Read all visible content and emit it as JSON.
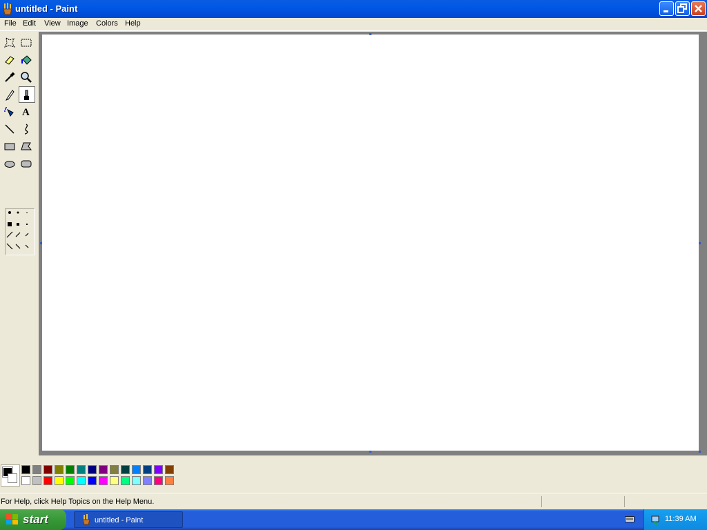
{
  "window": {
    "title": "untitled - Paint"
  },
  "menu": [
    "File",
    "Edit",
    "View",
    "Image",
    "Colors",
    "Help"
  ],
  "tools": [
    {
      "name": "free-form-select-icon"
    },
    {
      "name": "select-icon"
    },
    {
      "name": "eraser-icon"
    },
    {
      "name": "fill-icon"
    },
    {
      "name": "pick-color-icon"
    },
    {
      "name": "magnifier-icon"
    },
    {
      "name": "pencil-icon"
    },
    {
      "name": "brush-icon",
      "selected": true
    },
    {
      "name": "airbrush-icon"
    },
    {
      "name": "text-icon"
    },
    {
      "name": "line-icon"
    },
    {
      "name": "curve-icon"
    },
    {
      "name": "rectangle-icon"
    },
    {
      "name": "polygon-icon"
    },
    {
      "name": "ellipse-icon"
    },
    {
      "name": "rounded-rectangle-icon"
    }
  ],
  "palette": {
    "foreground": "#000000",
    "background": "#ffffff",
    "top_row": [
      "#000000",
      "#808080",
      "#800000",
      "#808000",
      "#008000",
      "#008080",
      "#000080",
      "#800080",
      "#808040",
      "#004040",
      "#0080ff",
      "#004080",
      "#8000ff",
      "#804000"
    ],
    "bottom_row": [
      "#ffffff",
      "#c0c0c0",
      "#ff0000",
      "#ffff00",
      "#00ff00",
      "#00ffff",
      "#0000ff",
      "#ff00ff",
      "#ffff80",
      "#00ff80",
      "#80ffff",
      "#8080ff",
      "#ff0080",
      "#ff8040"
    ]
  },
  "status": {
    "text": "For Help, click Help Topics on the Help Menu."
  },
  "taskbar": {
    "start_label": "start",
    "task_label": "untitled - Paint",
    "clock": "11:39 AM"
  }
}
